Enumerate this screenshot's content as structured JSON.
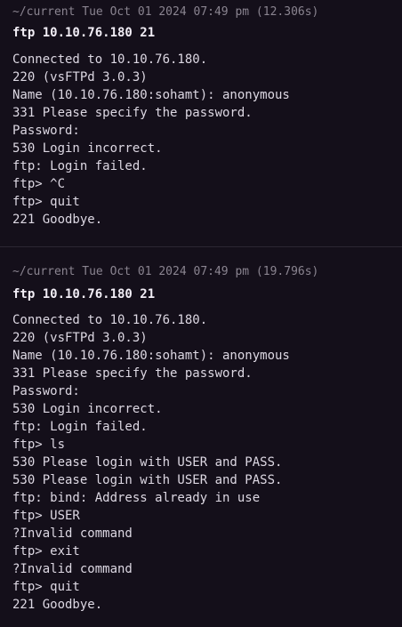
{
  "blocks": [
    {
      "header": "~/current Tue Oct 01 2024 07:49 pm (12.306s)",
      "command": "ftp 10.10.76.180 21",
      "output": [
        "Connected to 10.10.76.180.",
        "220 (vsFTPd 3.0.3)",
        "Name (10.10.76.180:sohamt): anonymous",
        "331 Please specify the password.",
        "Password:",
        "530 Login incorrect.",
        "ftp: Login failed.",
        "ftp> ^C",
        "ftp> quit",
        "221 Goodbye."
      ]
    },
    {
      "header": "~/current Tue Oct 01 2024 07:49 pm (19.796s)",
      "command": "ftp 10.10.76.180 21",
      "output": [
        "Connected to 10.10.76.180.",
        "220 (vsFTPd 3.0.3)",
        "Name (10.10.76.180:sohamt): anonymous",
        "331 Please specify the password.",
        "Password:",
        "530 Login incorrect.",
        "ftp: Login failed.",
        "ftp> ls",
        "530 Please login with USER and PASS.",
        "530 Please login with USER and PASS.",
        "ftp: bind: Address already in use",
        "ftp> USER",
        "?Invalid command",
        "ftp> exit",
        "?Invalid command",
        "ftp> quit",
        "221 Goodbye."
      ]
    }
  ]
}
